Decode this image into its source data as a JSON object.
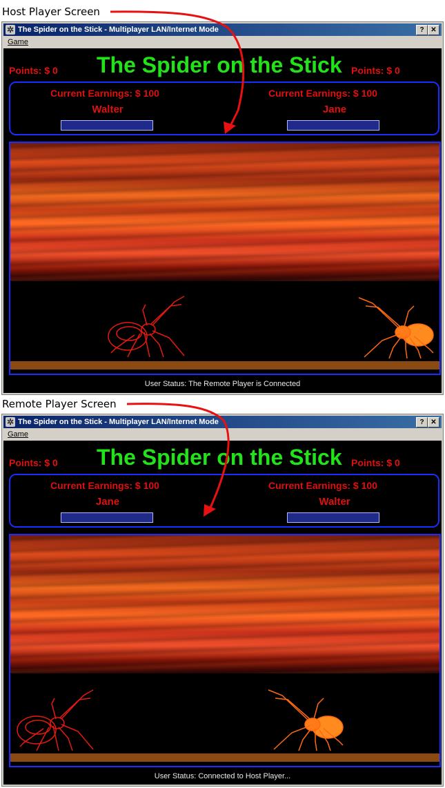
{
  "colors": {
    "title_green": "#22e31a",
    "score_red": "#e01010",
    "panel_blue": "#1b2cff"
  },
  "screens": [
    {
      "caption": "Host Player Screen",
      "window_title": "The Spider on the Stick - Multiplayer LAN/Internet Mode",
      "help_btn": "?",
      "close_btn": "✕",
      "menu_game": "Game",
      "game_title": "The Spider on the Stick",
      "left_points": "Points: $     0",
      "right_points": "Points: $     0",
      "left_earnings": "Current Earnings: $   100",
      "right_earnings": "Current Earnings: $   100",
      "left_player": "Walter",
      "right_player": "Jane",
      "status": "User Status: The Remote Player is Connected"
    },
    {
      "caption": "Remote Player Screen",
      "window_title": "The Spider on the Stick - Multiplayer LAN/Internet Mode",
      "help_btn": "?",
      "close_btn": "✕",
      "menu_game": "Game",
      "game_title": "The Spider on the Stick",
      "left_points": "Points: $     0",
      "right_points": "Points: $     0",
      "left_earnings": "Current Earnings: $   100",
      "right_earnings": "Current Earnings: $   100",
      "left_player": "Jane",
      "right_player": "Walter",
      "status": "User Status: Connected to Host Player..."
    }
  ]
}
